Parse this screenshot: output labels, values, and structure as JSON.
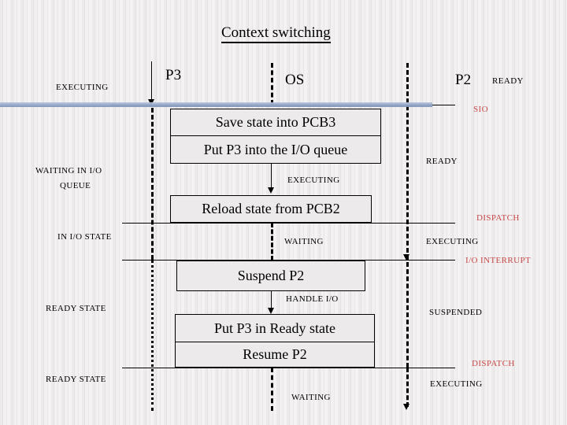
{
  "title": "Context switching",
  "colors": {
    "accent_red": "#c94a4a",
    "bar_blue": "#8fa3c4",
    "box_fill": "#eceaea",
    "line_black": "#000000"
  },
  "lanes": {
    "p3_label": "P3",
    "os_label": "OS",
    "p2_label": "P2"
  },
  "left_states": [
    {
      "text": "EXECUTING"
    },
    {
      "text": "WAITING IN I/O"
    },
    {
      "text": "QUEUE"
    },
    {
      "text": "IN I/O STATE"
    },
    {
      "text": "READY STATE"
    },
    {
      "text": "READY STATE"
    }
  ],
  "right_states": [
    {
      "text": "READY"
    },
    {
      "text": "SIO",
      "color": "red"
    },
    {
      "text": "READY"
    },
    {
      "text": "DISPATCH",
      "color": "red"
    },
    {
      "text": "EXECUTING"
    },
    {
      "text": "I/O INTERRUPT",
      "color": "red"
    },
    {
      "text": "SUSPENDED"
    },
    {
      "text": "DISPATCH",
      "color": "red"
    },
    {
      "text": "EXECUTING"
    }
  ],
  "os_annotations": [
    {
      "text": "EXECUTING"
    },
    {
      "text": "WAITING"
    },
    {
      "text": "HANDLE I/O"
    },
    {
      "text": "WAITING"
    }
  ],
  "boxes": [
    {
      "text": "Save state into PCB3"
    },
    {
      "text": "Put P3 into the I/O queue"
    },
    {
      "text": "Reload state from PCB2"
    },
    {
      "text": "Suspend P2"
    },
    {
      "text": "Put P3 in Ready state"
    },
    {
      "text": "Resume P2"
    }
  ]
}
